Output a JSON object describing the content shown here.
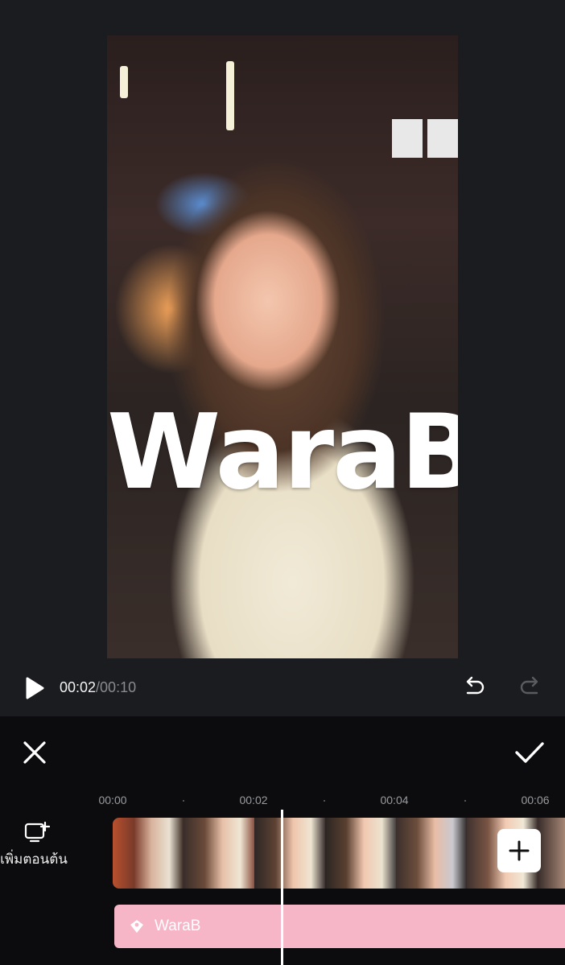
{
  "preview": {
    "overlay_text": "WaraB"
  },
  "player": {
    "current_time": "00:02",
    "total_time": "/00:10"
  },
  "timeline": {
    "ticks": [
      "00:00",
      "00:02",
      "00:04",
      "00:06"
    ],
    "add_intro_label": "เพิ่มตอนต้น",
    "text_clip_label": "WaraB"
  },
  "colors": {
    "text_clip": "#f7b6c8",
    "background": "#17181c",
    "panel": "#0c0c0e"
  }
}
